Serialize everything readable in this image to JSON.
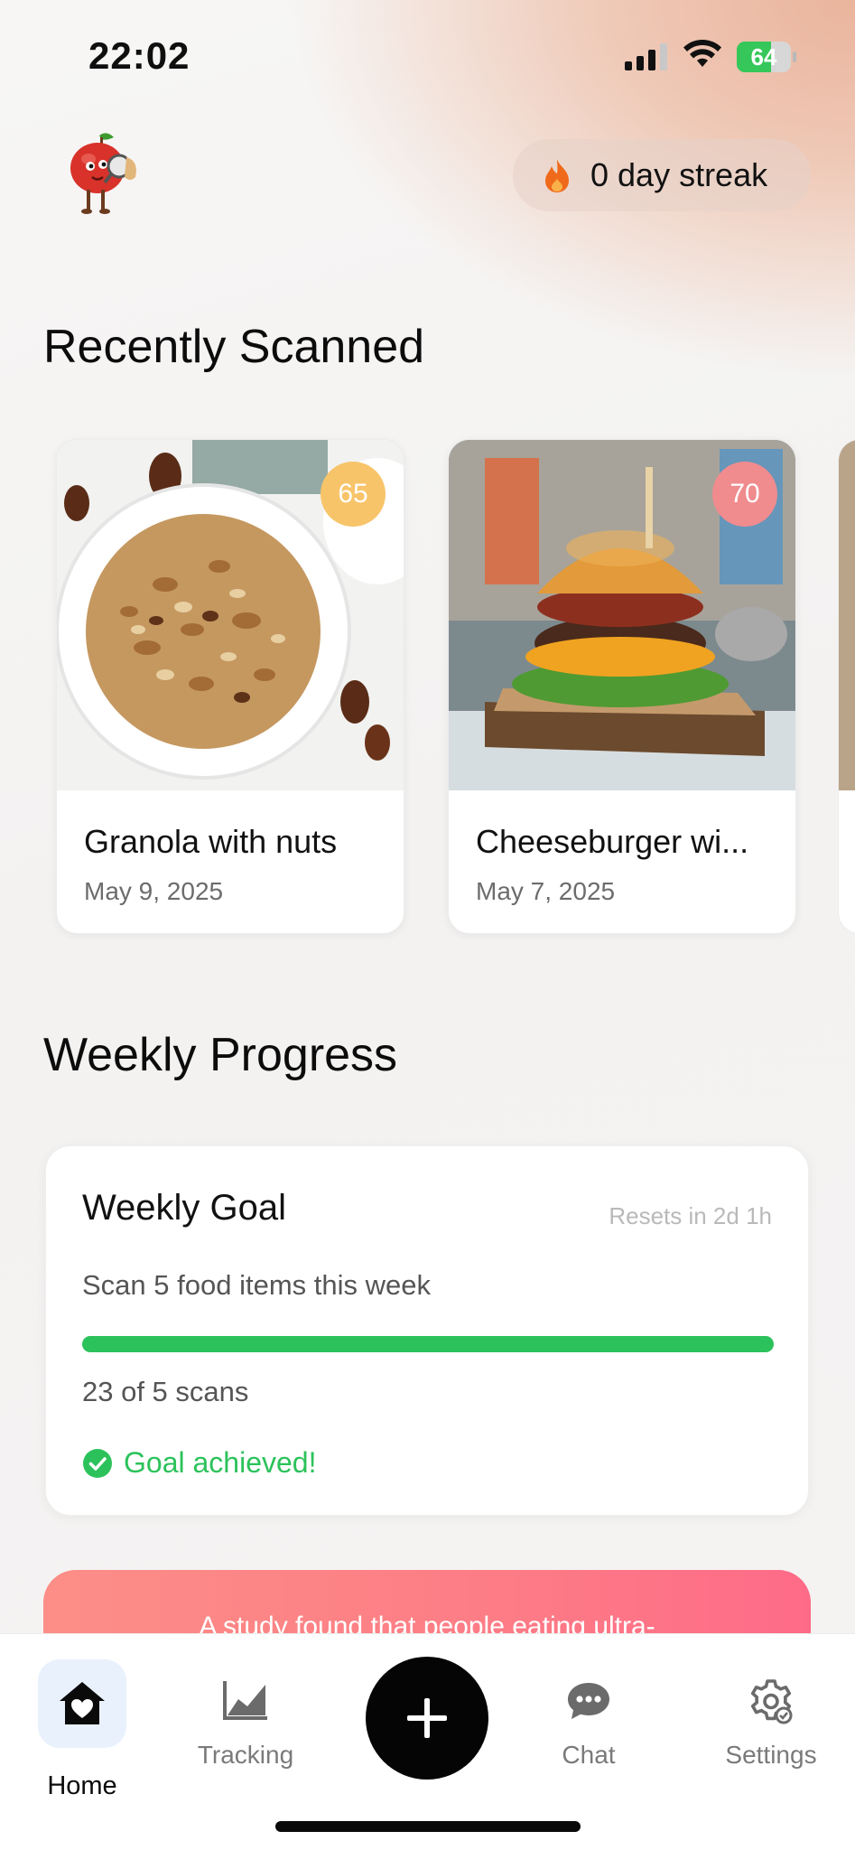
{
  "status_bar": {
    "time": "22:02",
    "battery_level": "64",
    "battery_fraction": 0.64,
    "signal_bars": 3
  },
  "header": {
    "streak_label": "0 day streak",
    "icons": [
      "apple-mascot-icon",
      "flame-icon"
    ]
  },
  "recently_scanned": {
    "title": "Recently Scanned",
    "items": [
      {
        "name": "Granola with nuts",
        "date": "May 9, 2025",
        "score": "65",
        "score_color": "#f8c46a"
      },
      {
        "name": "Cheeseburger wi...",
        "date": "May 7, 2025",
        "score": "70",
        "score_color": "#f08b8e"
      }
    ]
  },
  "weekly_progress": {
    "title": "Weekly Progress",
    "goal": {
      "title": "Weekly Goal",
      "resets": "Resets in 2d 1h",
      "description": "Scan 5 food items this week",
      "progress_fraction": 1.0,
      "count_text": "23 of 5 scans",
      "achieved_text": "Goal achieved!"
    }
  },
  "study_banner": {
    "text": "A study found that people eating ultra-"
  },
  "tab_bar": {
    "tabs": [
      {
        "label": "Home",
        "icon": "home-heart-icon",
        "active": true
      },
      {
        "label": "Tracking",
        "icon": "chart-icon",
        "active": false
      },
      {
        "label": "",
        "icon": "plus-icon",
        "active": false
      },
      {
        "label": "Chat",
        "icon": "chat-bubble-icon",
        "active": false
      },
      {
        "label": "Settings",
        "icon": "gear-icon",
        "active": false
      }
    ]
  },
  "colors": {
    "accent_green": "#2cc25b",
    "streak_flame": "#f06a1b",
    "fab": "#050505"
  }
}
